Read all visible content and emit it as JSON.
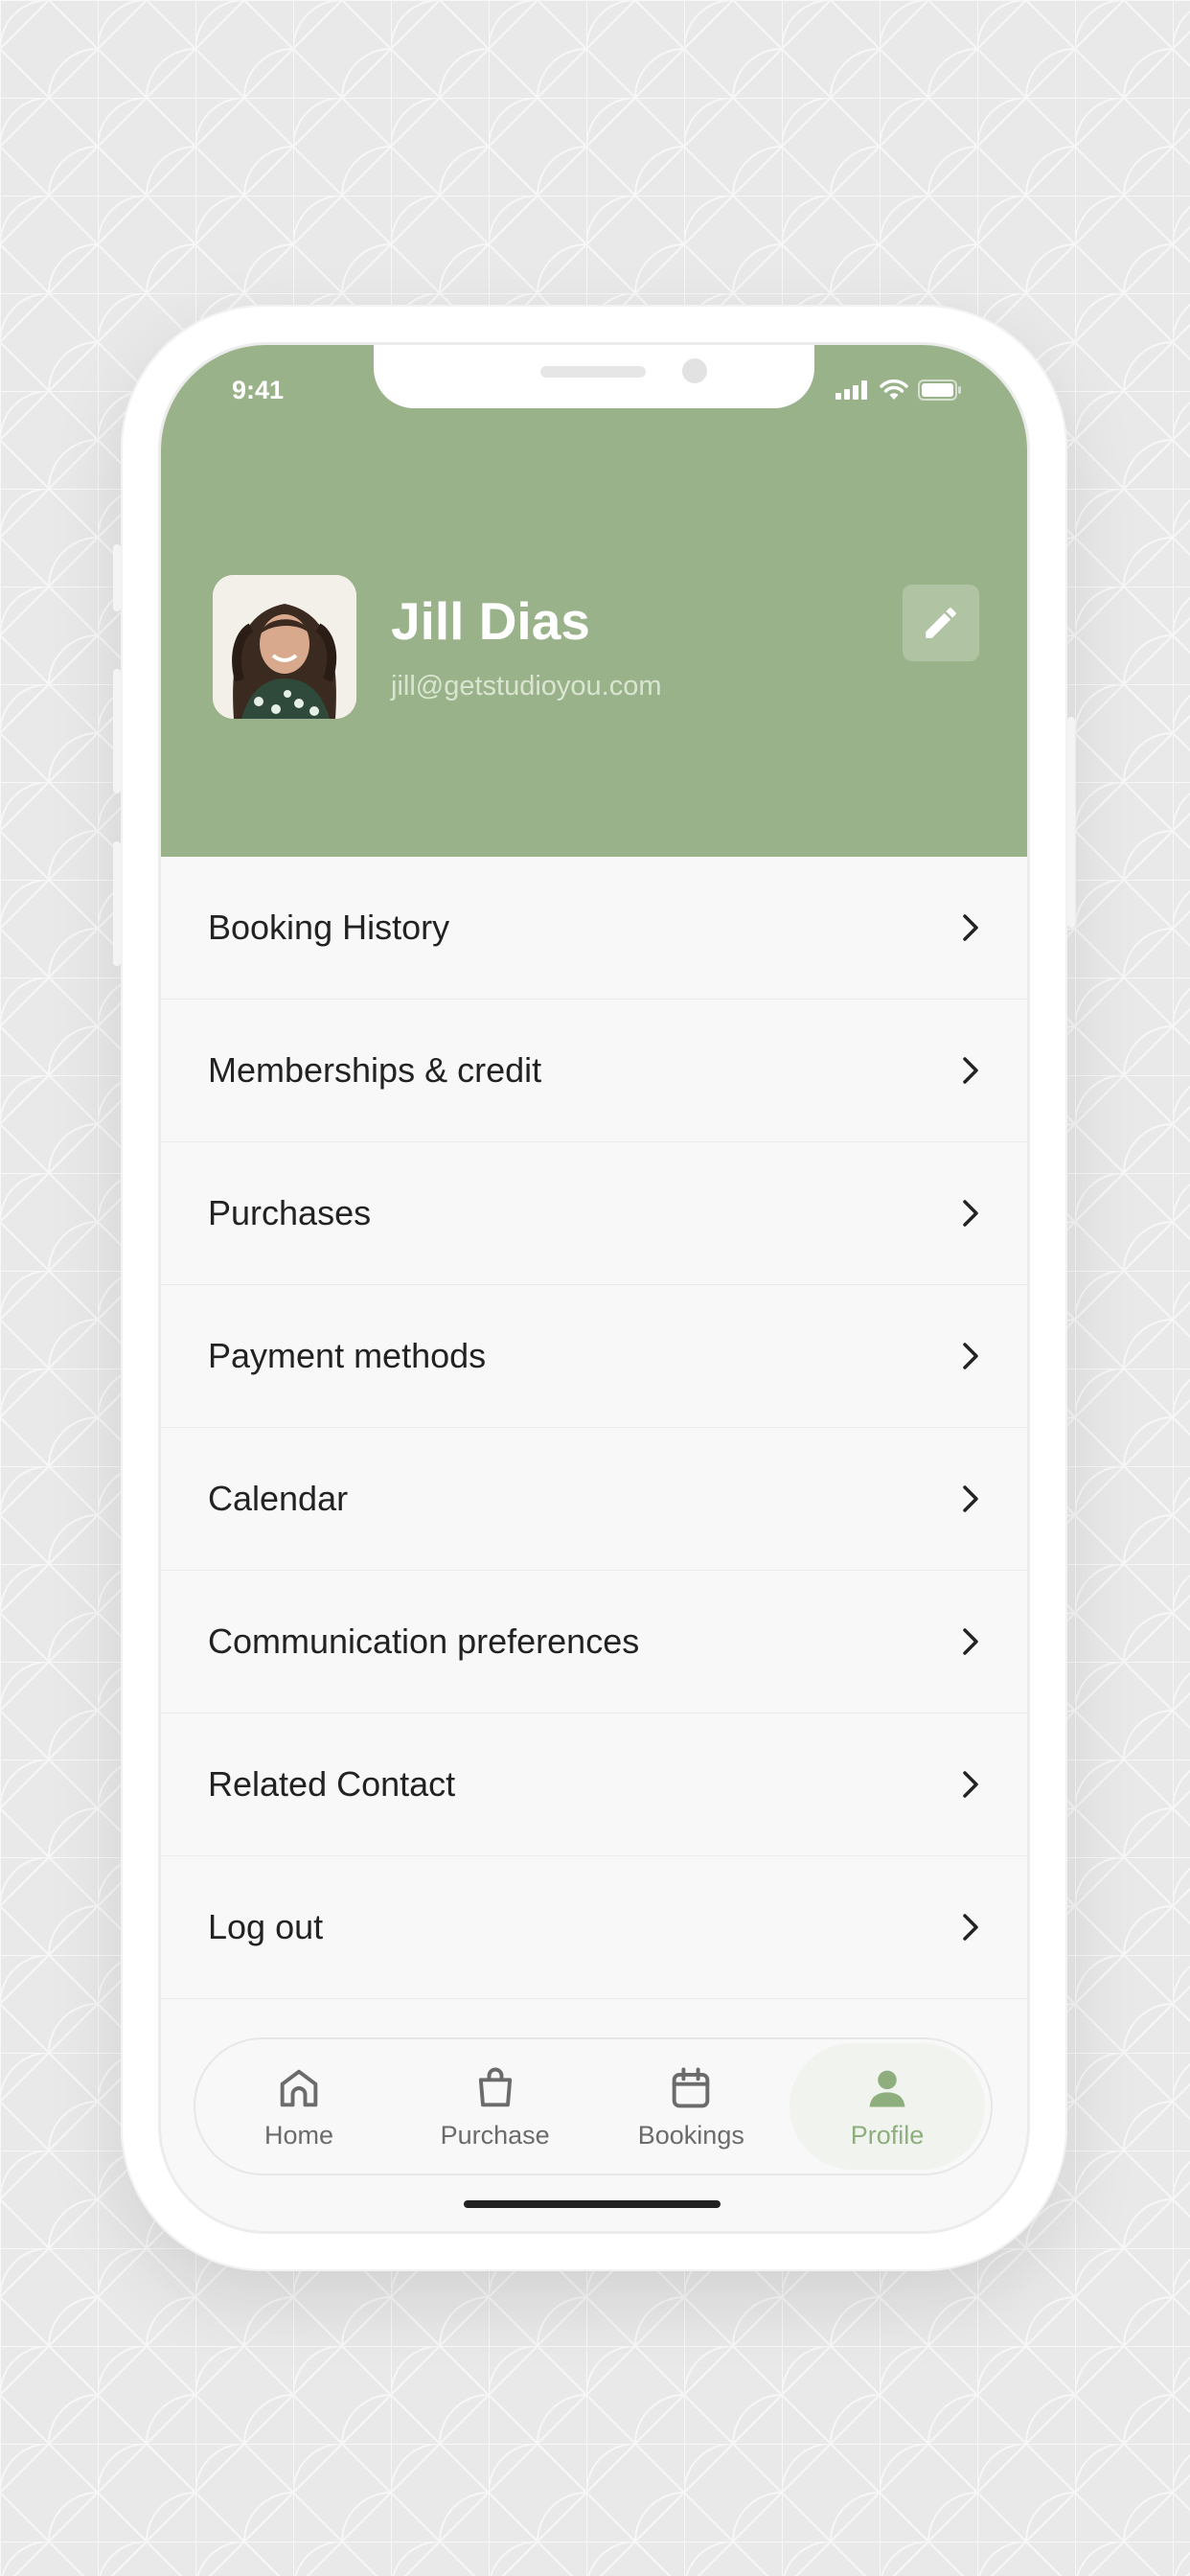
{
  "status_bar": {
    "time": "9:41"
  },
  "profile": {
    "name": "Jill Dias",
    "email": "jill@getstudioyou.com"
  },
  "menu": {
    "items": [
      {
        "label": "Booking History"
      },
      {
        "label": "Memberships & credit"
      },
      {
        "label": "Purchases"
      },
      {
        "label": "Payment methods"
      },
      {
        "label": "Calendar"
      },
      {
        "label": "Communication preferences"
      },
      {
        "label": "Related Contact"
      },
      {
        "label": "Log out"
      }
    ]
  },
  "tabs": {
    "items": [
      {
        "label": "Home",
        "icon": "home-icon"
      },
      {
        "label": "Purchase",
        "icon": "shopping-bag-icon"
      },
      {
        "label": "Bookings",
        "icon": "calendar-icon"
      },
      {
        "label": "Profile",
        "icon": "user-icon"
      }
    ],
    "active": "Profile"
  },
  "colors": {
    "header": "#9ab28a",
    "accent": "#8fae7d",
    "background": "#f8f8f8",
    "text": "#222222"
  }
}
